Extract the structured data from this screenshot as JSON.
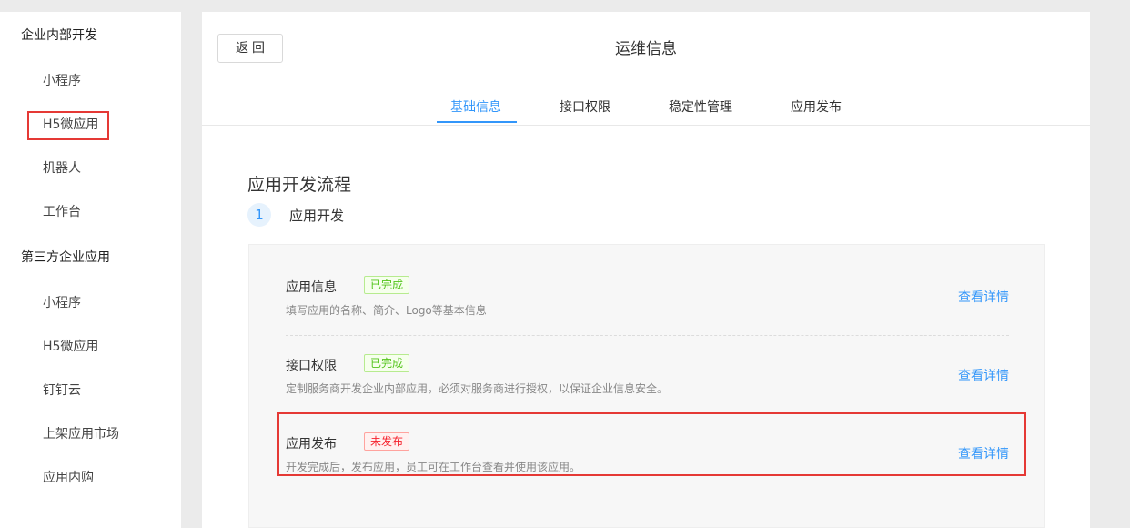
{
  "sidebar": {
    "groups": [
      {
        "label": "企业内部开发",
        "items": [
          "小程序",
          "H5微应用",
          "机器人",
          "工作台"
        ]
      },
      {
        "label": "第三方企业应用",
        "items": [
          "小程序",
          "H5微应用",
          "钉钉云",
          "上架应用市场",
          "应用内购"
        ]
      }
    ]
  },
  "header": {
    "back_label": "返回",
    "title": "运维信息"
  },
  "tabs": [
    "基础信息",
    "接口权限",
    "稳定性管理",
    "应用发布"
  ],
  "active_tab": "基础信息",
  "section": {
    "title": "应用开发流程",
    "step_number": "1",
    "step_label": "应用开发"
  },
  "rows": [
    {
      "title": "应用信息",
      "status": "已完成",
      "desc": "填写应用的名称、简介、Logo等基本信息",
      "link": "查看详情"
    },
    {
      "title": "接口权限",
      "status": "已完成",
      "desc": "定制服务商开发企业内部应用，必须对服务商进行授权，以保证企业信息安全。",
      "link": "查看详情"
    },
    {
      "title": "应用发布",
      "status": "未发布",
      "desc": "开发完成后，发布应用，员工可在工作台查看并使用该应用。",
      "link": "查看详情"
    }
  ],
  "colors": {
    "accent": "#3296fa",
    "done": "#52c41a",
    "todo": "#f5222d",
    "highlight": "#e53935"
  }
}
